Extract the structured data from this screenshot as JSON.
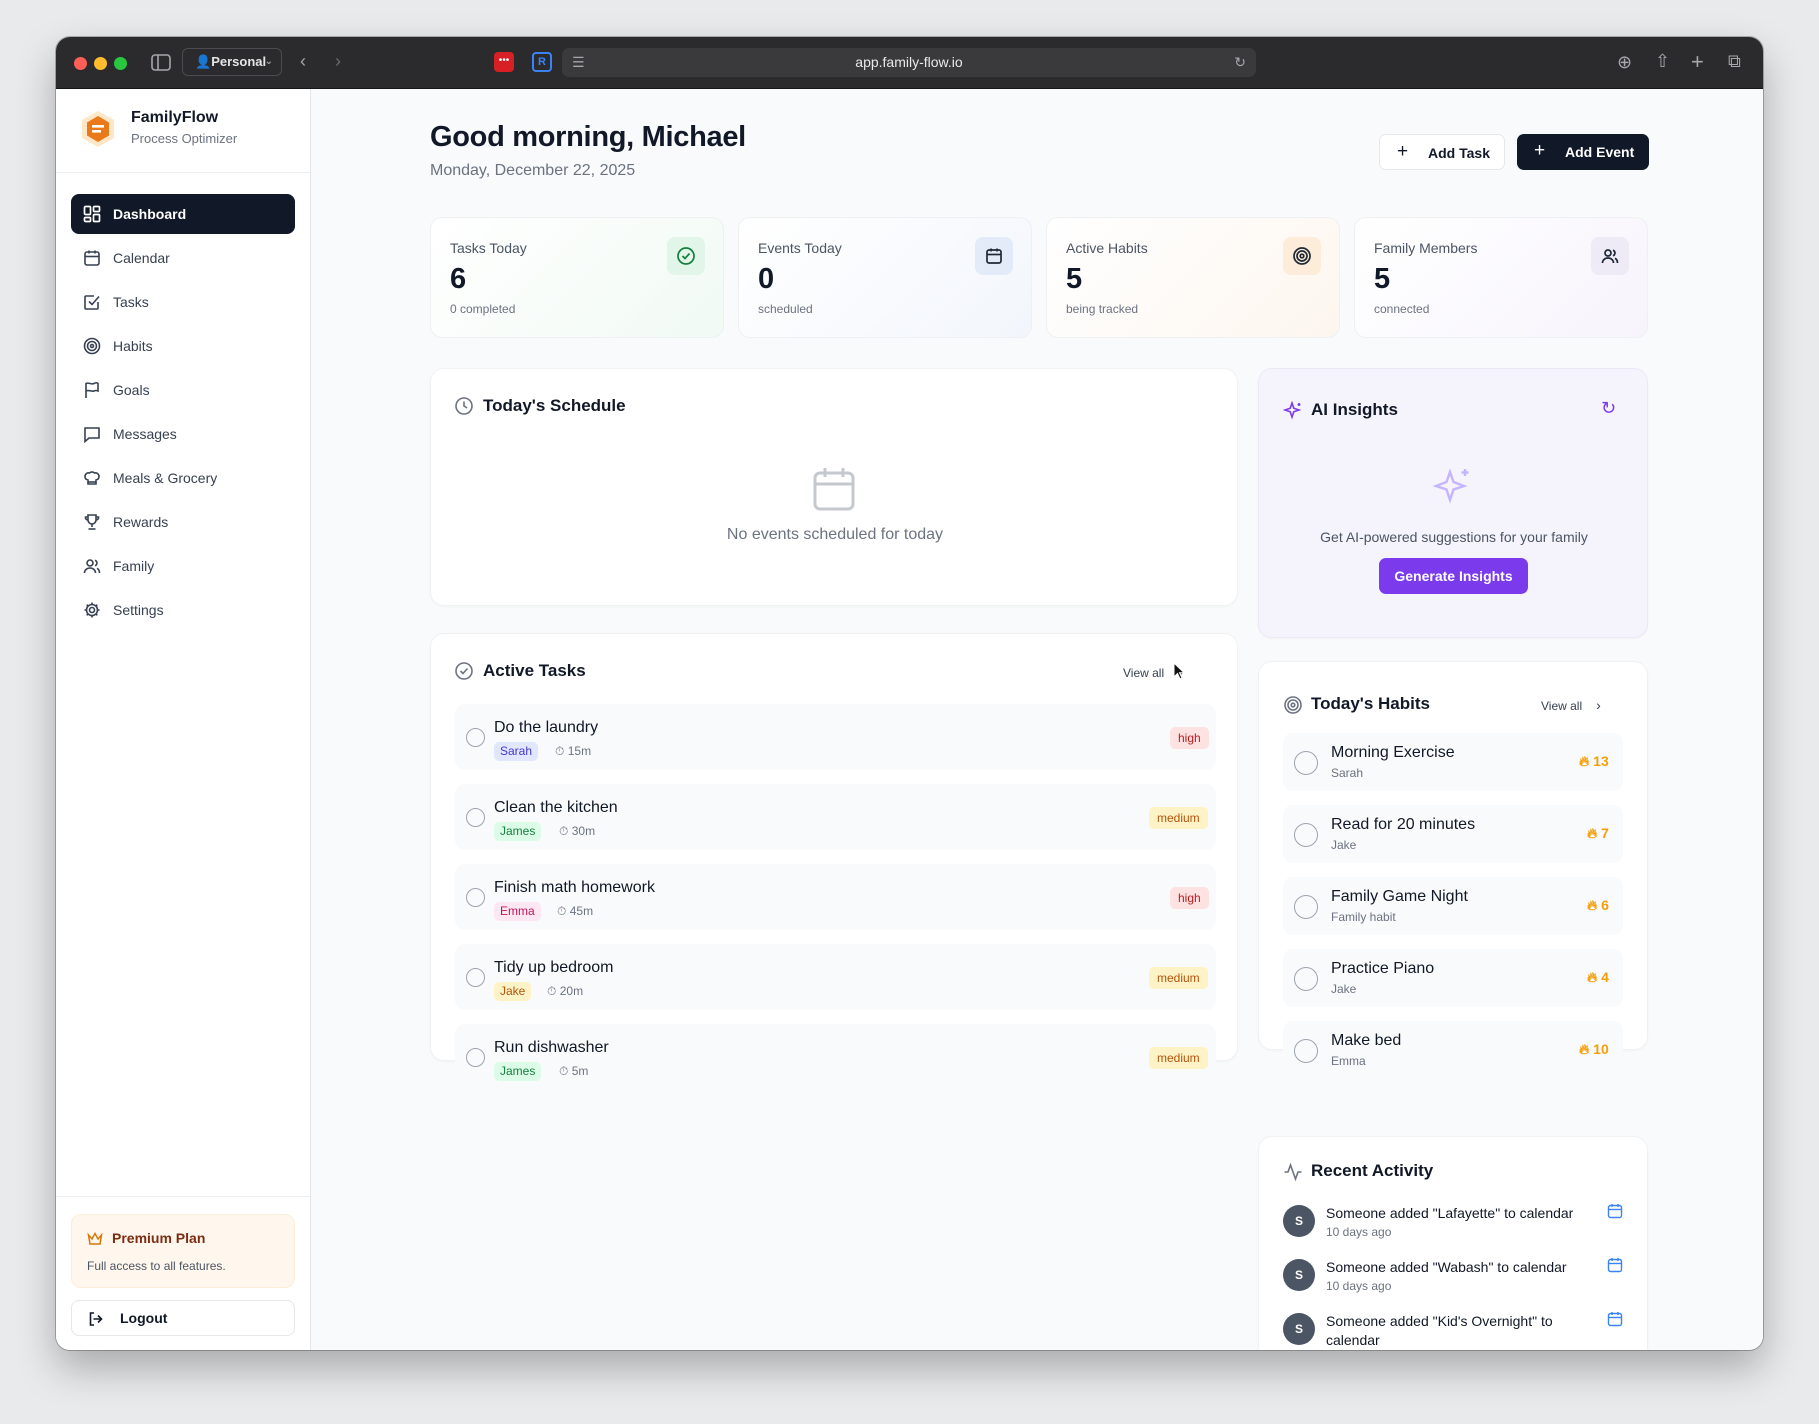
{
  "browser": {
    "profile": "Personal",
    "url": "app.family-flow.io"
  },
  "brand": {
    "name": "FamilyFlow",
    "tagline": "Process Optimizer"
  },
  "nav": [
    {
      "label": "Dashboard",
      "icon": "grid-icon",
      "active": true
    },
    {
      "label": "Calendar",
      "icon": "calendar-icon"
    },
    {
      "label": "Tasks",
      "icon": "checkbox-icon"
    },
    {
      "label": "Habits",
      "icon": "target-icon"
    },
    {
      "label": "Goals",
      "icon": "flag-icon"
    },
    {
      "label": "Messages",
      "icon": "message-icon"
    },
    {
      "label": "Meals & Grocery",
      "icon": "chef-hat-icon"
    },
    {
      "label": "Rewards",
      "icon": "trophy-icon"
    },
    {
      "label": "Family",
      "icon": "users-icon"
    },
    {
      "label": "Settings",
      "icon": "gear-icon"
    }
  ],
  "premium": {
    "title": "Premium Plan",
    "desc": "Full access to all features."
  },
  "logout_label": "Logout",
  "header": {
    "greeting": "Good morning, Michael",
    "date": "Monday, December 22, 2025",
    "add_task": "Add Task",
    "add_event": "Add Event"
  },
  "stats": [
    {
      "label": "Tasks Today",
      "value": "6",
      "sub": "0 completed",
      "icon": "check-circle-icon",
      "color": "#16a34a"
    },
    {
      "label": "Events Today",
      "value": "0",
      "sub": "scheduled",
      "icon": "calendar-icon",
      "color": "#2563eb"
    },
    {
      "label": "Active Habits",
      "value": "5",
      "sub": "being tracked",
      "icon": "target-icon",
      "color": "#ea580c"
    },
    {
      "label": "Family Members",
      "value": "5",
      "sub": "connected",
      "icon": "users-icon",
      "color": "#7c3aed"
    }
  ],
  "schedule": {
    "title": "Today's Schedule",
    "empty": "No events scheduled for today"
  },
  "tasks": {
    "title": "Active Tasks",
    "view_all": "View all",
    "items": [
      {
        "name": "Do the laundry",
        "assignee": "Sarah",
        "duration": "15m",
        "priority": "high"
      },
      {
        "name": "Clean the kitchen",
        "assignee": "James",
        "duration": "30m",
        "priority": "medium"
      },
      {
        "name": "Finish math homework",
        "assignee": "Emma",
        "duration": "45m",
        "priority": "high"
      },
      {
        "name": "Tidy up bedroom",
        "assignee": "Jake",
        "duration": "20m",
        "priority": "medium"
      },
      {
        "name": "Run dishwasher",
        "assignee": "James",
        "duration": "5m",
        "priority": "medium"
      }
    ]
  },
  "insights": {
    "title": "AI Insights",
    "desc": "Get AI-powered suggestions for your family",
    "button": "Generate Insights"
  },
  "habits": {
    "title": "Today's Habits",
    "view_all": "View all",
    "items": [
      {
        "name": "Morning Exercise",
        "who": "Sarah",
        "streak": "13"
      },
      {
        "name": "Read for 20 minutes",
        "who": "Jake",
        "streak": "7"
      },
      {
        "name": "Family Game Night",
        "who": "Family habit",
        "streak": "6"
      },
      {
        "name": "Practice Piano",
        "who": "Jake",
        "streak": "4"
      },
      {
        "name": "Make bed",
        "who": "Emma",
        "streak": "10"
      }
    ]
  },
  "activity": {
    "title": "Recent Activity",
    "items": [
      {
        "avatar": "S",
        "text": "Someone added \"Lafayette\" to calendar",
        "time": "10 days ago"
      },
      {
        "avatar": "S",
        "text": "Someone added \"Wabash\" to calendar",
        "time": "10 days ago"
      },
      {
        "avatar": "S",
        "text": "Someone added \"Kid's Overnight\" to calendar",
        "time": ""
      }
    ]
  }
}
